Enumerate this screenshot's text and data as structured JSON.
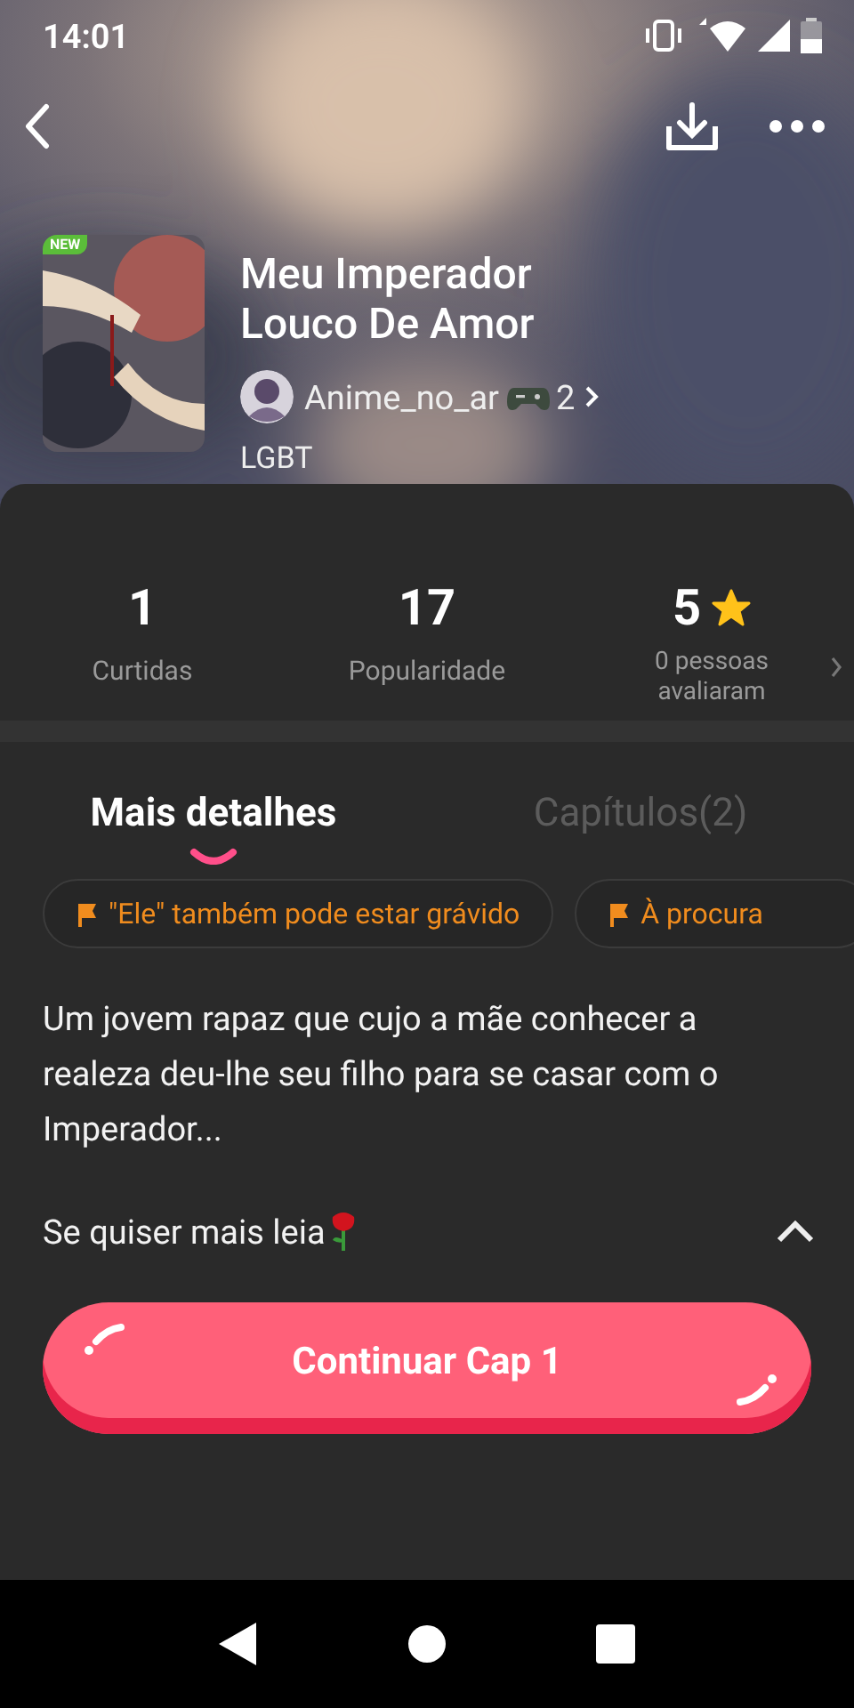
{
  "status_bar": {
    "time": "14:01"
  },
  "book": {
    "title": "Meu Imperador Louco De Amor",
    "badge": "NEW",
    "author": {
      "name": "Anime_no_ar",
      "suffix": "2"
    },
    "category": "LGBT"
  },
  "stats": [
    {
      "kind": "plain",
      "value": "1",
      "label": "Curtidas"
    },
    {
      "kind": "plain",
      "value": "17",
      "label": "Popularidade"
    },
    {
      "kind": "rating",
      "value": "5",
      "label": "0 pessoas avaliaram"
    }
  ],
  "tabs": [
    {
      "label": "Mais detalhes",
      "selected": true
    },
    {
      "label": "Capítulos(2)",
      "selected": false
    }
  ],
  "tags": [
    "\"Ele\" também pode estar grávido",
    "À procura"
  ],
  "description": {
    "text": "Um jovem rapaz que cujo a mãe conhecer a realeza deu-lhe seu filho para se casar com o Imperador...",
    "more": "Se quiser mais leia",
    "expanded": true
  },
  "continue_button": "Continuar Cap 1"
}
